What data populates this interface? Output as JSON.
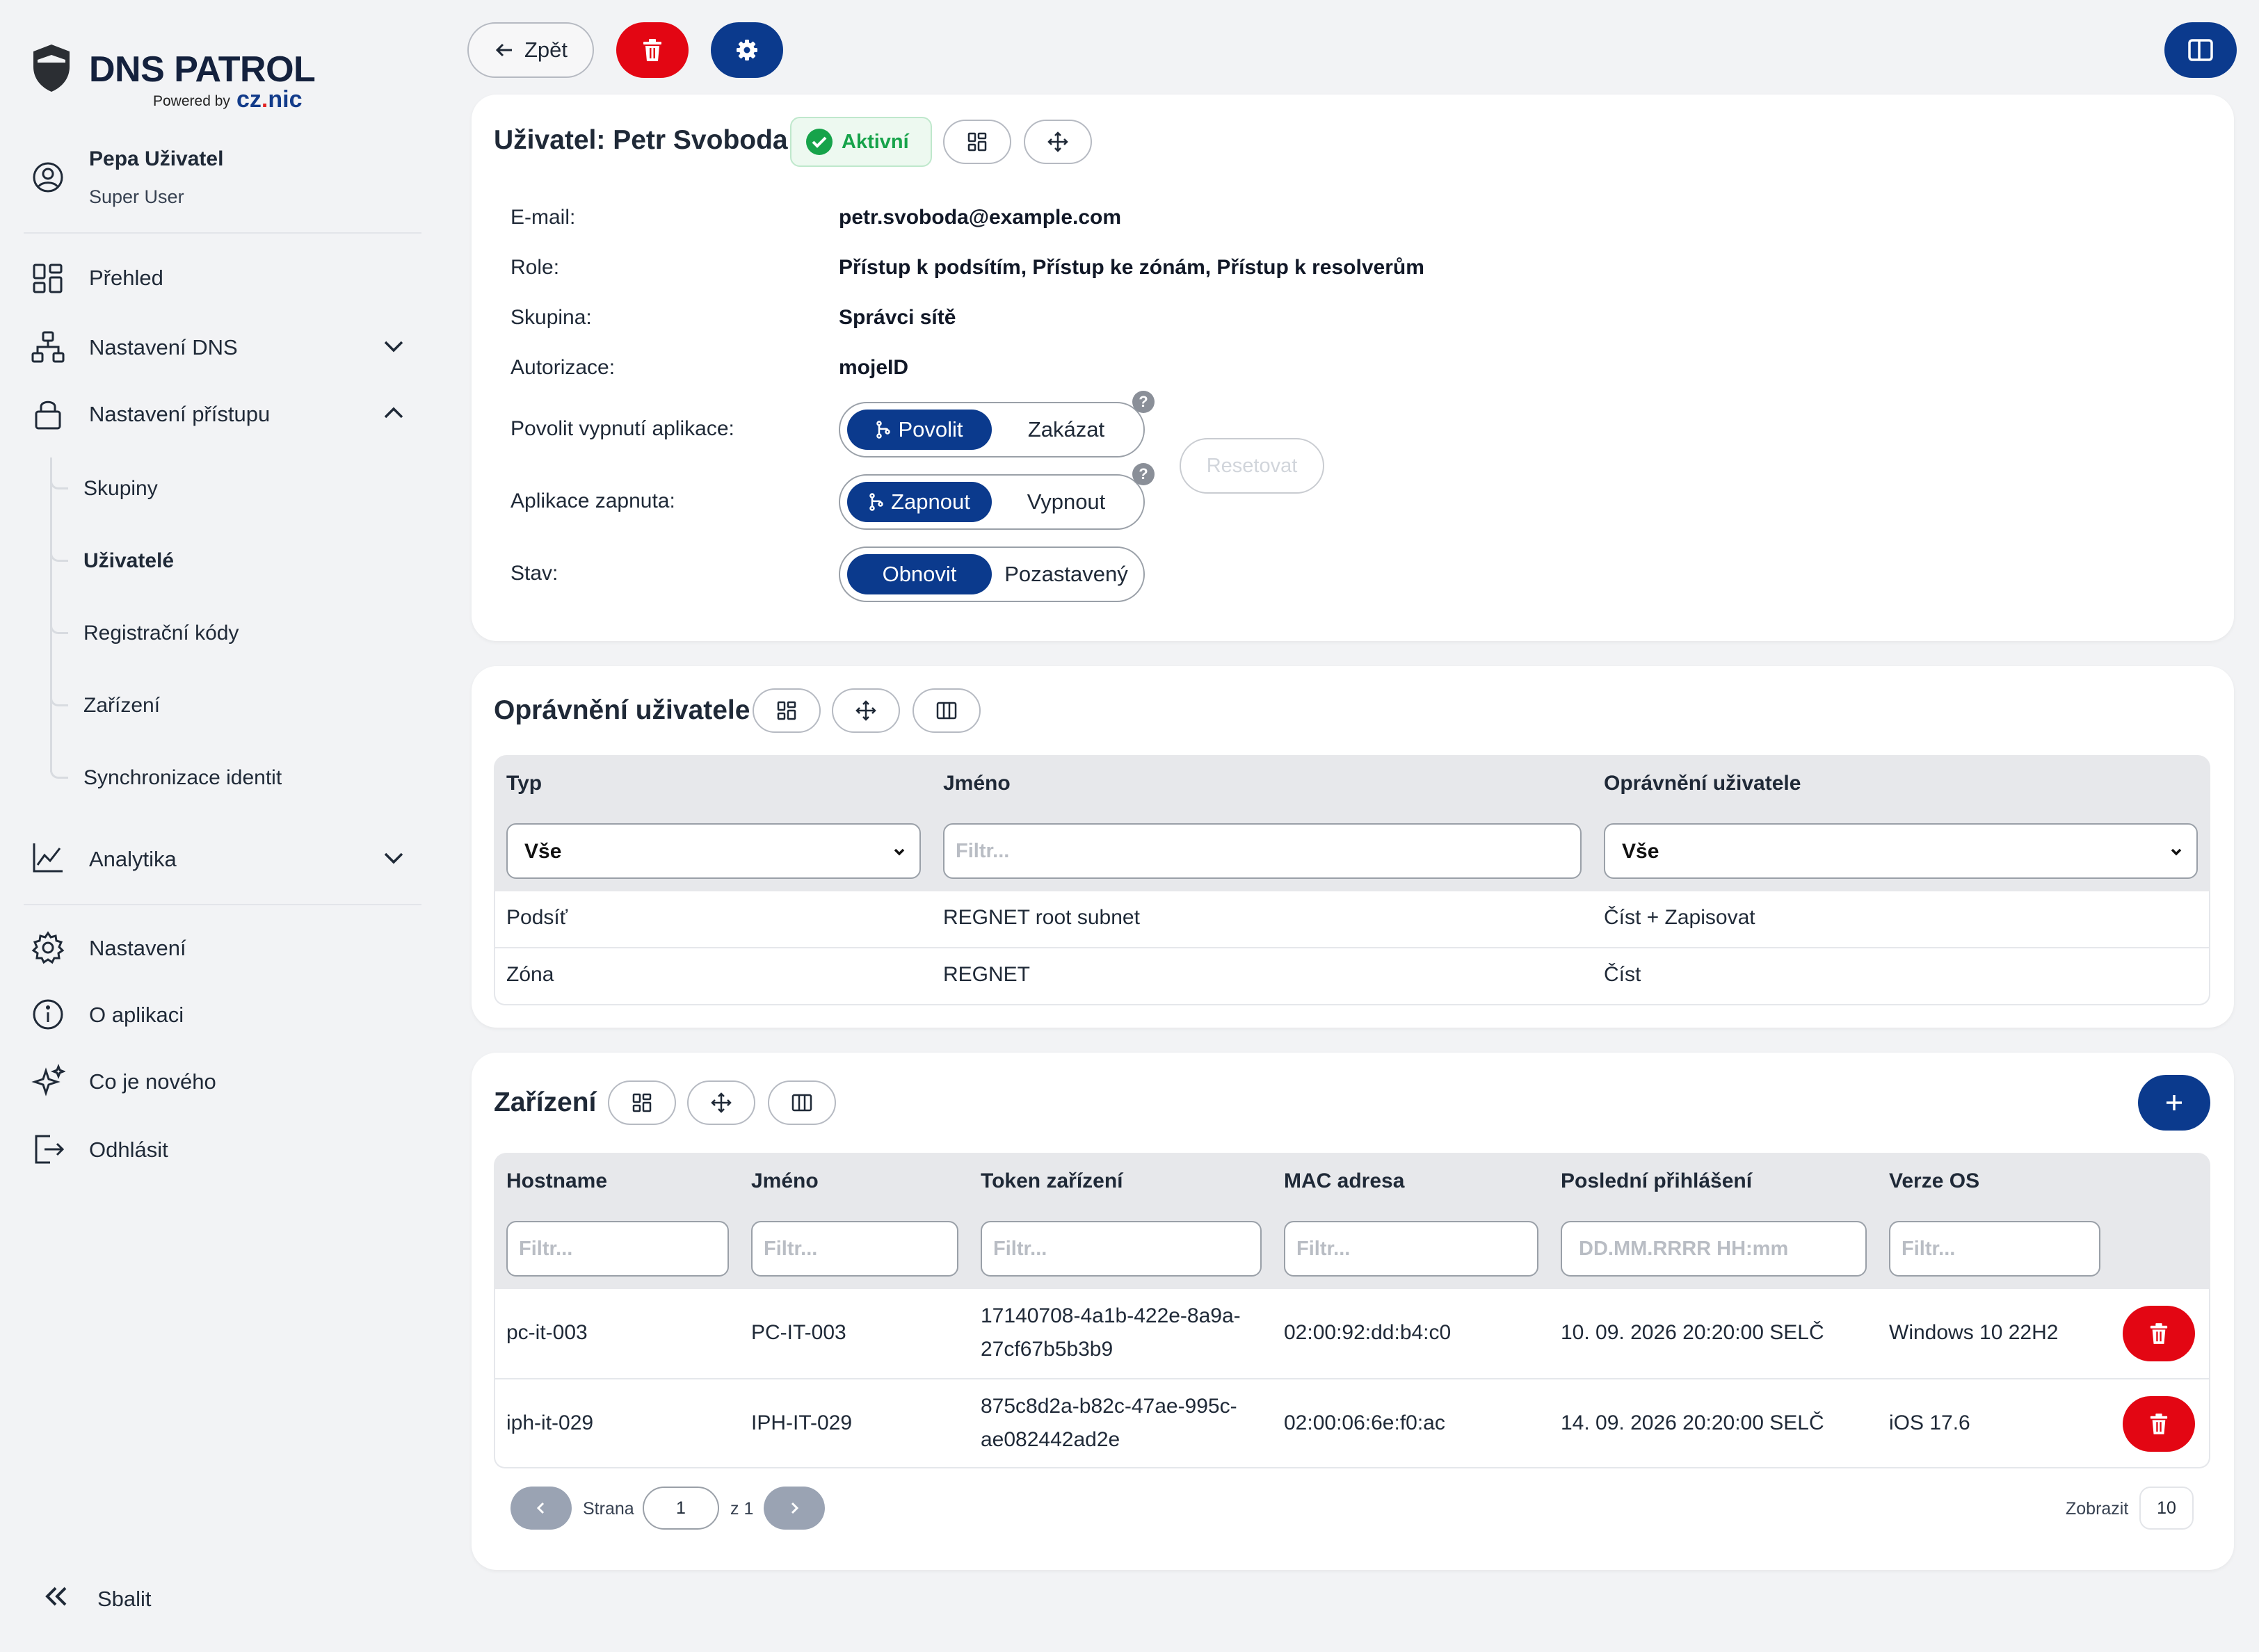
{
  "brand": {
    "title": "DNS PATROL",
    "powered_by": "Powered by",
    "partner": "cz.nic"
  },
  "user": {
    "name": "Pepa Uživatel",
    "role": "Super User"
  },
  "nav": {
    "overview": "Přehled",
    "dns_settings": "Nastavení DNS",
    "access_settings": "Nastavení přístupu",
    "sub": [
      "Skupiny",
      "Uživatelé",
      "Registrační kódy",
      "Zařízení",
      "Synchronizace identit"
    ],
    "analytics": "Analytika",
    "settings": "Nastavení",
    "about": "O aplikaci",
    "whats_new": "Co je nového",
    "logout": "Odhlásit",
    "collapse": "Sbalit"
  },
  "toolbar": {
    "back_label": "Zpět"
  },
  "detail": {
    "title": "Uživatel: Petr Svoboda",
    "status": "Aktivní",
    "fields": [
      {
        "label": "E-mail:",
        "value": "petr.svoboda@example.com"
      },
      {
        "label": "Role:",
        "value": "Přístup k podsítím, Přístup ke zónám, Přístup k resolverům"
      },
      {
        "label": "Skupina:",
        "value": "Správci sítě"
      },
      {
        "label": "Autorizace:",
        "value": "mojeID"
      }
    ],
    "allow_disable": {
      "label": "Povolit vypnutí aplikace:",
      "on": "Povolit",
      "off": "Zakázat"
    },
    "app_enabled": {
      "label": "Aplikace zapnuta:",
      "on": "Zapnout",
      "off": "Vypnout"
    },
    "state": {
      "label": "Stav:",
      "on": "Obnovit",
      "off": "Pozastavený"
    },
    "help": "?",
    "reset": "Resetovat"
  },
  "permissions": {
    "title": "Oprávnění uživatele",
    "columns": [
      "Typ",
      "Jméno",
      "Oprávnění uživatele"
    ],
    "filters": {
      "type": "Vše",
      "name_placeholder": "Filtr...",
      "perm": "Vše"
    },
    "rows": [
      {
        "type": "Podsíť",
        "name": "REGNET root subnet",
        "perm": "Číst + Zapisovat"
      },
      {
        "type": "Zóna",
        "name": "REGNET",
        "perm": "Číst"
      }
    ]
  },
  "devices": {
    "title": "Zařízení",
    "columns": [
      "Hostname",
      "Jméno",
      "Token zařízení",
      "MAC adresa",
      "Poslední přihlášení",
      "Verze OS"
    ],
    "filter_placeholder": "Filtr...",
    "date_placeholder": "DD.MM.RRRR HH:mm",
    "rows": [
      {
        "hostname": "pc-it-003",
        "name": "PC-IT-003",
        "token1": "17140708-4a1b-422e-8a9a-",
        "token2": "27cf67b5b3b9",
        "mac": "02:00:92:dd:b4:c0",
        "last_login": "10. 09. 2026 20:20:00 SELČ",
        "os": "Windows 10 22H2"
      },
      {
        "hostname": "iph-it-029",
        "name": "IPH-IT-029",
        "token1": "875c8d2a-b82c-47ae-995c-",
        "token2": "ae082442ad2e",
        "mac": "02:00:06:6e:f0:ac",
        "last_login": "14. 09. 2026 20:20:00 SELČ",
        "os": "iOS 17.6"
      }
    ],
    "pagination": {
      "page_label": "Strana",
      "page": "1",
      "of_label": "z 1",
      "show_label": "Zobrazit",
      "page_size": "10"
    }
  },
  "colors": {
    "navy": "#0b3a8d",
    "red": "#e30613",
    "green": "#16a34a",
    "bg": "#f2f3f5"
  }
}
